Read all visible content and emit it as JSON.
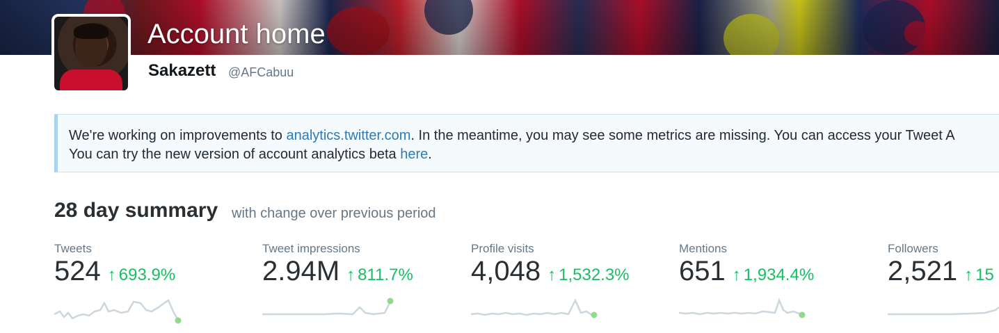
{
  "header": {
    "title": "Account home",
    "display_name": "Sakazett",
    "handle": "@AFCabuu"
  },
  "notice": {
    "line1_before": "We're working on improvements to ",
    "line1_link": "analytics.twitter.com",
    "line1_after": ". In the meantime, you may see some metrics are missing. You can access your Tweet A",
    "line2_before": "You can try the new version of account analytics beta ",
    "line2_link": "here",
    "line2_after": "."
  },
  "summary": {
    "title": "28 day summary",
    "subtitle": "with change over previous period",
    "metrics": [
      {
        "label": "Tweets",
        "value": "524",
        "change": "693.9%"
      },
      {
        "label": "Tweet impressions",
        "value": "2.94M",
        "change": "811.7%"
      },
      {
        "label": "Profile visits",
        "value": "4,048",
        "change": "1,532.3%"
      },
      {
        "label": "Mentions",
        "value": "651",
        "change": "1,934.4%"
      },
      {
        "label": "Followers",
        "value": "2,521",
        "change": "15"
      }
    ]
  },
  "colors": {
    "positive": "#17bf63",
    "link": "#2b7bb9",
    "sparkline": "#ccd6dd",
    "notice_bg": "#f5fafd"
  },
  "icons": {
    "change": "arrow-up-icon",
    "sparkline_end": "dot-marker-icon"
  }
}
